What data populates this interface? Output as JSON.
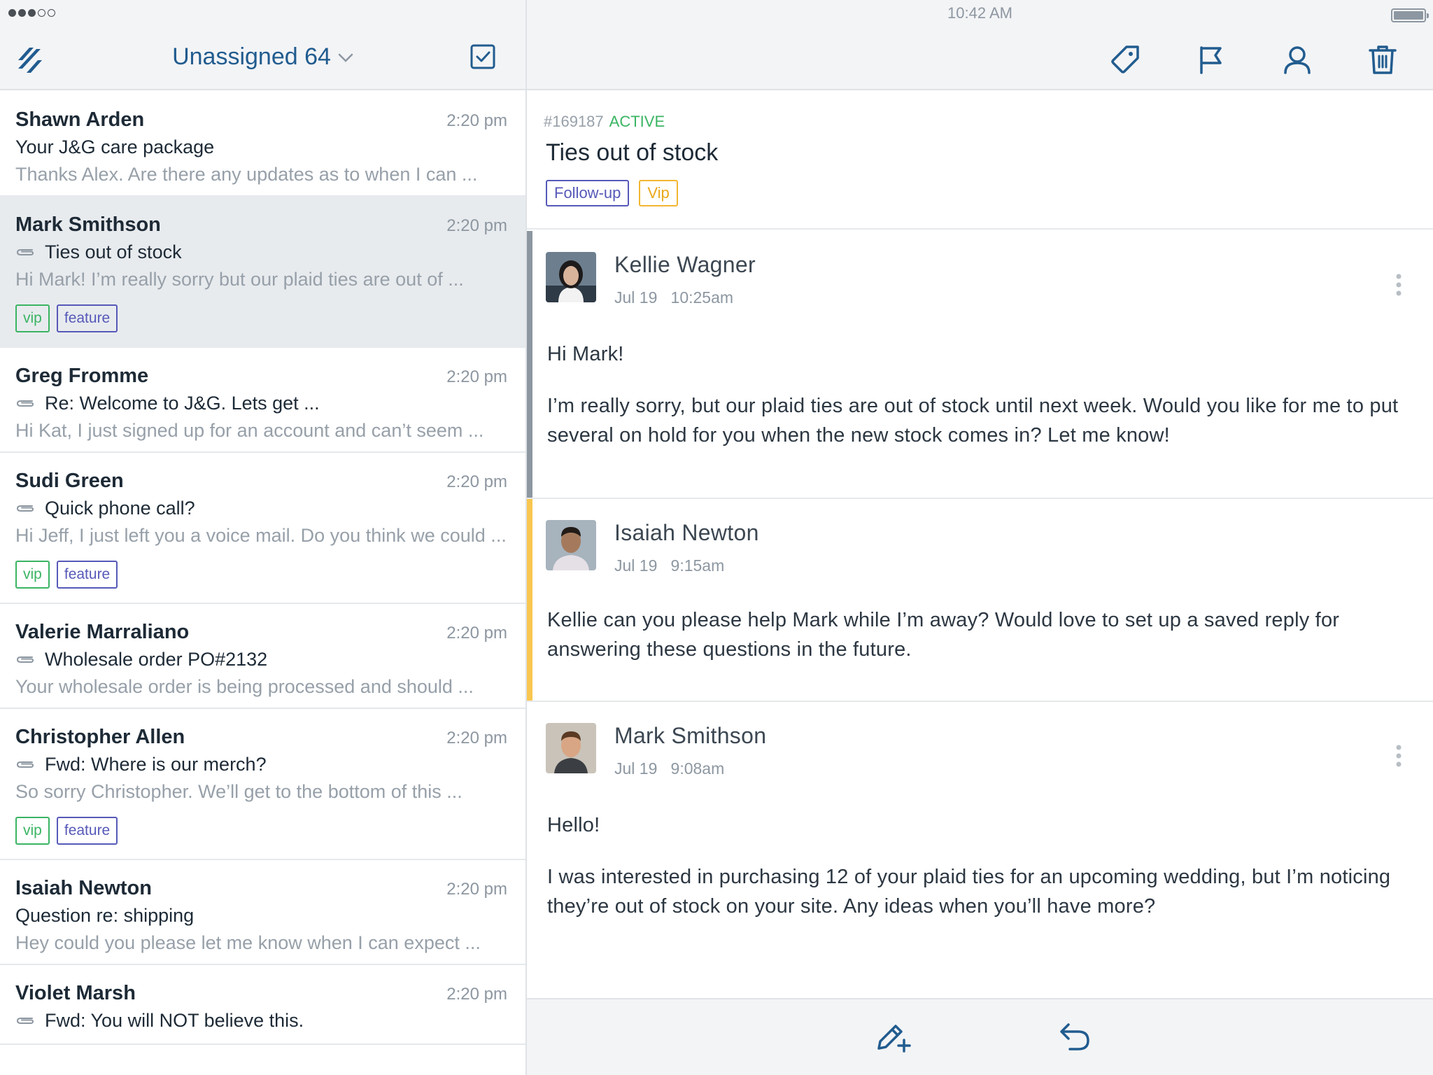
{
  "status_bar": {
    "time": "10:42 AM"
  },
  "colors": {
    "brand_blue": "#215c8f",
    "active_green": "#3ab463",
    "tag_purple": "#5659b8",
    "tag_yellow": "#f2b632",
    "internal_note_bar": "#f9c74f",
    "reply_bar": "#8d97a1"
  },
  "left_header": {
    "folder_title": "Unassigned 64",
    "logo_icon": "helpscout-logo",
    "select_icon": "checkbox-square-icon"
  },
  "conversations": [
    {
      "name": "Shawn Arden",
      "time": "2:20 pm",
      "subject": "Your J&G care package",
      "preview": "Thanks Alex. Are there any updates as to when I can ...",
      "has_attachment": false,
      "tags": []
    },
    {
      "name": "Mark Smithson",
      "time": "2:20 pm",
      "subject": "Ties out of stock",
      "preview": "Hi Mark! I’m really sorry but our plaid ties are out of ...",
      "has_attachment": true,
      "tags": [
        "vip",
        "feature"
      ],
      "selected": true
    },
    {
      "name": "Greg Fromme",
      "time": "2:20 pm",
      "subject": "Re: Welcome to J&G. Lets get ...",
      "preview": "Hi Kat, I just signed up for an account and can’t seem ...",
      "has_attachment": true,
      "tags": []
    },
    {
      "name": "Sudi Green",
      "time": "2:20 pm",
      "subject": "Quick phone call?",
      "preview": "Hi Jeff, I just left you a voice mail. Do you think we could  ...",
      "has_attachment": true,
      "tags": [
        "vip",
        "feature"
      ]
    },
    {
      "name": "Valerie Marraliano",
      "time": "2:20 pm",
      "subject": "Wholesale order PO#2132",
      "preview": "Your wholesale order is being processed and should ...",
      "has_attachment": true,
      "tags": []
    },
    {
      "name": "Christopher Allen",
      "time": "2:20 pm",
      "subject": "Fwd: Where is our merch?",
      "preview": "So sorry Christopher. We’ll get to the bottom of this ...",
      "has_attachment": true,
      "tags": [
        "vip",
        "feature"
      ]
    },
    {
      "name": "Isaiah Newton",
      "time": "2:20 pm",
      "subject": "Question re: shipping",
      "preview": "Hey could you please let me know when I can expect ...",
      "has_attachment": false,
      "tags": []
    },
    {
      "name": "Violet Marsh",
      "time": "2:20 pm",
      "subject": "Fwd: You will NOT believe this.",
      "preview": "",
      "has_attachment": true,
      "tags": []
    }
  ],
  "toolbar": {
    "icons": [
      "tag-icon",
      "flag-icon",
      "user-icon",
      "trash-icon"
    ]
  },
  "ticket": {
    "number": "#169187",
    "status": "ACTIVE",
    "subject": "Ties out of stock",
    "tags": [
      "Follow-up",
      "Vip"
    ]
  },
  "thread": [
    {
      "author": "Kellie Wagner",
      "date": "Jul 19",
      "time": "10:25am",
      "type": "reply",
      "paragraphs": [
        "Hi Mark!",
        "I’m really sorry, but our plaid ties are out of stock until next week. Would you like for me to put several on hold for you when the new stock comes in? Let me know!"
      ]
    },
    {
      "author": "Isaiah Newton",
      "date": "Jul 19",
      "time": "9:15am",
      "type": "note",
      "paragraphs": [
        "Kellie can you please help Mark while I’m away? Would love to set up a saved reply for answering these questions in the future."
      ]
    },
    {
      "author": "Mark Smithson",
      "date": "Jul 19",
      "time": "9:08am",
      "type": "customer",
      "paragraphs": [
        "Hello!",
        "I was interested in purchasing 12 of your plaid ties for an upcoming wedding, but I’m noticing they’re out of stock on your site. Any ideas when you’ll have more?"
      ]
    }
  ],
  "bottom_bar": {
    "icons": [
      "add-note-pencil-icon",
      "reply-icon"
    ]
  }
}
